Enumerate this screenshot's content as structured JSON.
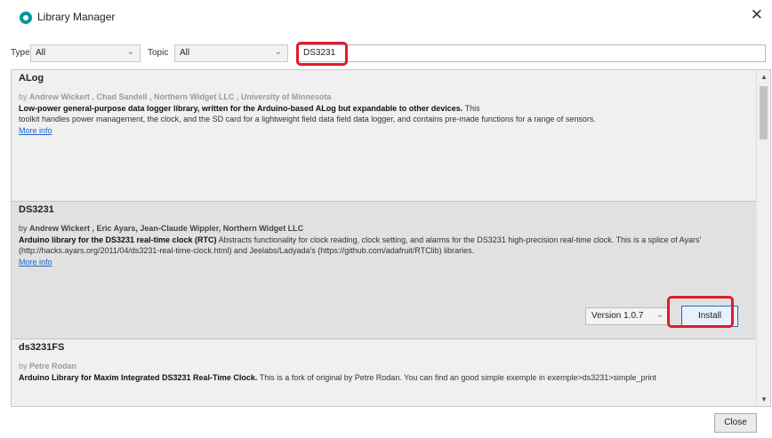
{
  "window": {
    "title": "Library Manager",
    "close_glyph": "✕",
    "app_icon": "arduino-logo-icon"
  },
  "filters": {
    "type_label": "Type",
    "type_value": "All",
    "topic_label": "Topic",
    "topic_value": "All",
    "search_value": "DS3231",
    "chevron": "⌄"
  },
  "libraries": [
    {
      "name": "ALog",
      "by_prefix": "by",
      "authors": "Andrew Wickert , Chad Sandell , Northern Widget LLC , University of Minnesota",
      "desc_bold": "Low-power general-purpose data logger library, written for the Arduino-based ALog but expandable to other devices.",
      "desc_line1": " This",
      "desc_rest": "toolkit handles power management, the clock, and the SD card for a lightweight field data field data logger, and contains pre-made functions for a range of sensors.",
      "more_info": "More info"
    },
    {
      "name": "DS3231",
      "by_prefix": "by",
      "authors": "Andrew Wickert , Eric Ayars, Jean-Claude Wippler, Northern Widget LLC",
      "desc_bold": "Arduino library for the DS3231 real-time clock (RTC)",
      "desc_rest": " Abstracts functionality for clock reading, clock setting, and alarms for the DS3231 high-precision real-time clock. This is a splice of Ayars' (http://hacks.ayars.org/2011/04/ds3231-real-time-clock.html) and Jeelabs/Ladyada's (https://github.com/adafruit/RTClib) libraries.",
      "more_info": "More info",
      "version_label": "Version 1.0.7",
      "install_label": "Install"
    },
    {
      "name": "ds3231FS",
      "by_prefix": "by",
      "authors": "Petre Rodan",
      "desc_bold": "Arduino Library for Maxim Integrated DS3231 Real-Time Clock.",
      "desc_rest": " This is a fork of original by Petre Rodan. You can find an good simple exemple in exemple>ds3231>simple_print"
    }
  ],
  "scrollbar": {
    "up": "▲",
    "down": "▼"
  },
  "footer": {
    "close_label": "Close"
  },
  "colors": {
    "highlight": "#e21b2d",
    "link": "#1e64c8",
    "selected_row": "#e1e1e1",
    "install_border": "#1a6fd0"
  }
}
